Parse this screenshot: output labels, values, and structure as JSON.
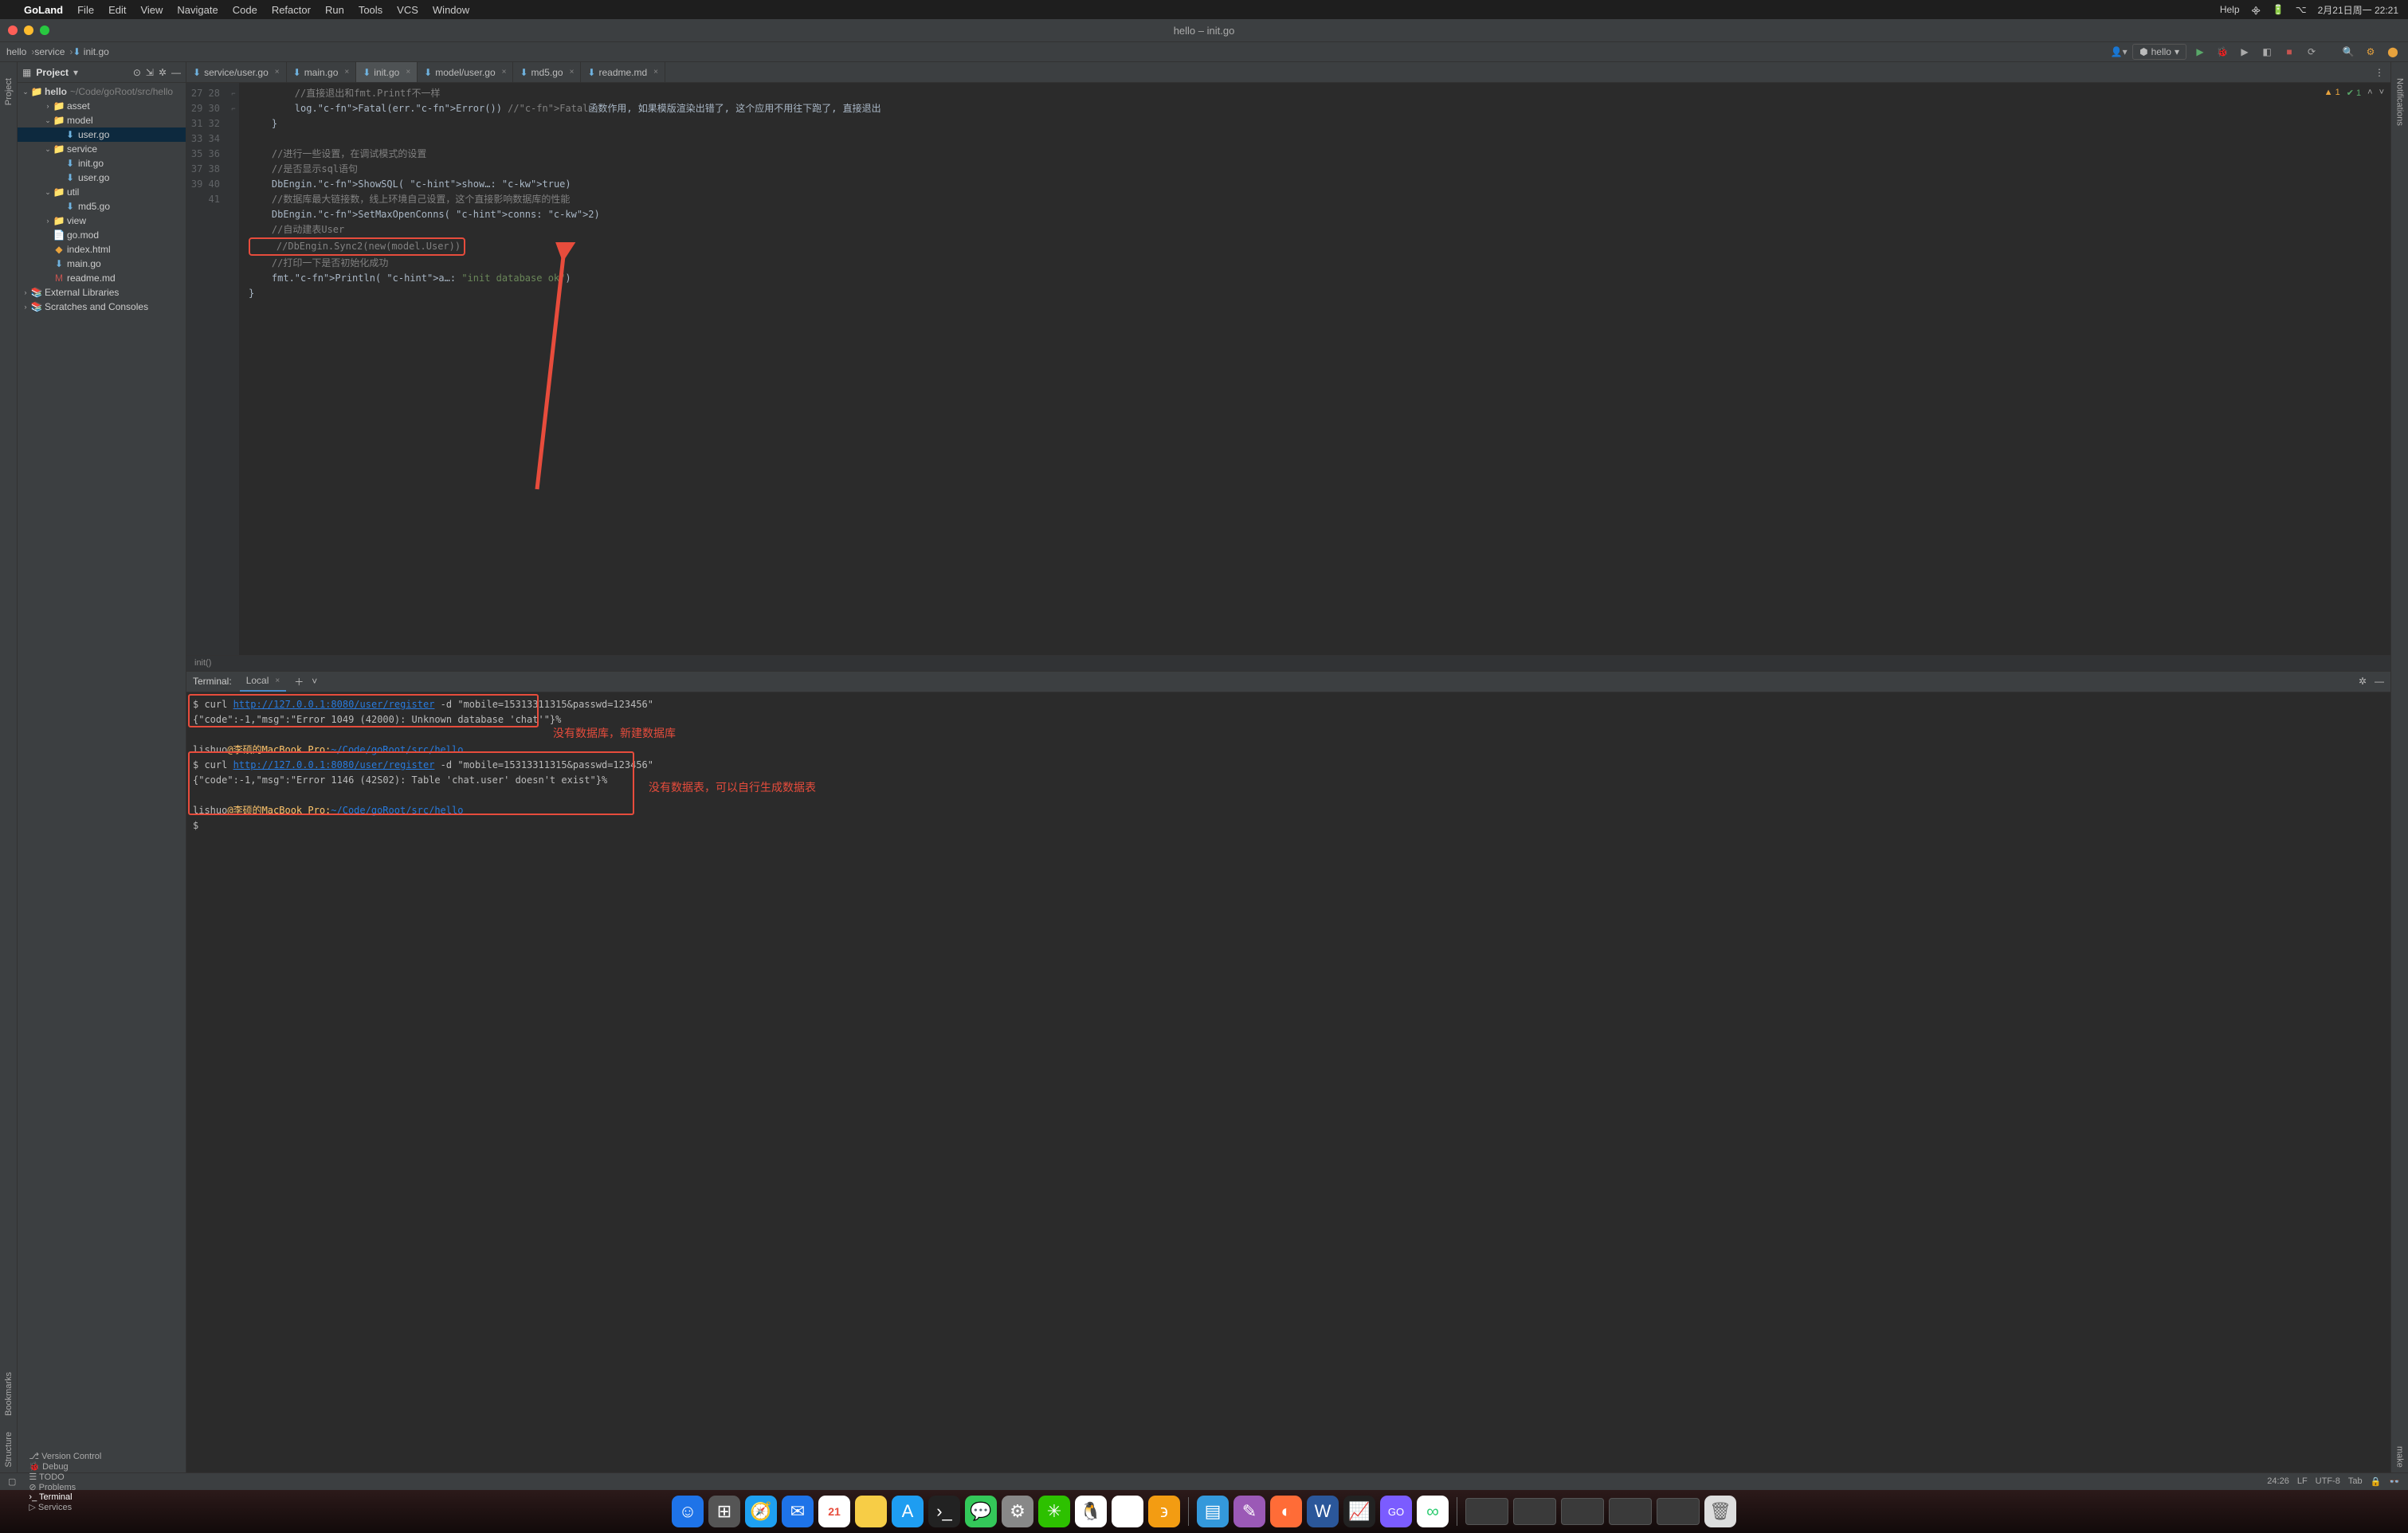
{
  "macbar": {
    "app": "GoLand",
    "menus": [
      "File",
      "Edit",
      "View",
      "Navigate",
      "Code",
      "Refactor",
      "Run",
      "Tools",
      "VCS",
      "Window"
    ],
    "help": "Help",
    "clock": "2月21日周一 22:21"
  },
  "titlebar": {
    "title": "hello – init.go"
  },
  "breadcrumbs": [
    "hello",
    "service",
    "init.go"
  ],
  "run_config": "hello",
  "project": {
    "title": "Project",
    "root": {
      "name": "hello",
      "path": "~/Code/goRoot/src/hello"
    },
    "tree": [
      {
        "name": "asset",
        "type": "dir",
        "depth": 2,
        "open": false
      },
      {
        "name": "model",
        "type": "dir",
        "depth": 2,
        "open": true
      },
      {
        "name": "user.go",
        "type": "go",
        "depth": 3,
        "sel": true
      },
      {
        "name": "service",
        "type": "dir",
        "depth": 2,
        "open": true
      },
      {
        "name": "init.go",
        "type": "go",
        "depth": 3
      },
      {
        "name": "user.go",
        "type": "go",
        "depth": 3
      },
      {
        "name": "util",
        "type": "dir",
        "depth": 2,
        "open": true
      },
      {
        "name": "md5.go",
        "type": "go",
        "depth": 3
      },
      {
        "name": "view",
        "type": "dir",
        "depth": 2,
        "open": false
      },
      {
        "name": "go.mod",
        "type": "file",
        "depth": 2
      },
      {
        "name": "index.html",
        "type": "html",
        "depth": 2
      },
      {
        "name": "main.go",
        "type": "go",
        "depth": 2
      },
      {
        "name": "readme.md",
        "type": "md",
        "depth": 2
      }
    ],
    "extra": [
      "External Libraries",
      "Scratches and Consoles"
    ]
  },
  "tabs": [
    {
      "file": "service/user.go"
    },
    {
      "file": "main.go"
    },
    {
      "file": "init.go",
      "active": true
    },
    {
      "file": "model/user.go"
    },
    {
      "file": "md5.go"
    },
    {
      "file": "readme.md"
    }
  ],
  "gutter_start": 27,
  "code_lines": [
    {
      "t": "cmt",
      "txt": "        //直接退出和fmt.Printf不一样"
    },
    {
      "t": "code",
      "txt": "        log.Fatal(err.Error()) //Fatal函数作用, 如果模版渲染出错了, 这个应用不用往下跑了, 直接退出"
    },
    {
      "t": "code",
      "txt": "    }"
    },
    {
      "t": "blank",
      "txt": ""
    },
    {
      "t": "cmt",
      "txt": "    //进行一些设置，在调试模式的设置"
    },
    {
      "t": "cmt",
      "txt": "    //是否显示sql语句"
    },
    {
      "t": "code",
      "txt": "    DbEngin.ShowSQL( show…: true)"
    },
    {
      "t": "cmt",
      "txt": "    //数据库最大链接数，线上环境自己设置，这个直接影响数据库的性能"
    },
    {
      "t": "code",
      "txt": "    DbEngin.SetMaxOpenConns( conns: 2)"
    },
    {
      "t": "cmt",
      "txt": "    //自动建表User"
    },
    {
      "t": "hi",
      "txt": "    //DbEngin.Sync2(new(model.User))"
    },
    {
      "t": "cmt",
      "txt": "    //打印一下是否初始化成功"
    },
    {
      "t": "code",
      "txt": "    fmt.Println( a…: \"init database ok\")"
    },
    {
      "t": "code",
      "txt": "}"
    },
    {
      "t": "blank",
      "txt": ""
    }
  ],
  "breadcrumb2": "init()",
  "inspection": {
    "warn": "1",
    "ok": "1"
  },
  "terminal": {
    "title": "Terminal:",
    "tab": "Local",
    "lines": [
      {
        "seg": [
          {
            "c": "p",
            "t": "$ curl "
          },
          {
            "c": "u",
            "t": "http://127.0.0.1:8080/user/register"
          },
          {
            "c": "p",
            "t": " -d \"mobile=15313311315&passwd=123456\""
          }
        ]
      },
      {
        "seg": [
          {
            "c": "p",
            "t": "{\"code\":-1,\"msg\":\"Error 1049 (42000): Unknown database 'chat'\"}%"
          }
        ]
      },
      {
        "seg": []
      },
      {
        "seg": [
          {
            "c": "user",
            "t": "lishuo"
          },
          {
            "c": "at",
            "t": "@李硕的MacBook Pro:"
          },
          {
            "c": "path",
            "t": "~/Code/goRoot/src/hello"
          }
        ]
      },
      {
        "seg": [
          {
            "c": "p",
            "t": "$ curl "
          },
          {
            "c": "u",
            "t": "http://127.0.0.1:8080/user/register"
          },
          {
            "c": "p",
            "t": " -d \"mobile=15313311315&passwd=123456\""
          }
        ]
      },
      {
        "seg": [
          {
            "c": "p",
            "t": "{\"code\":-1,\"msg\":\"Error 1146 (42S02): Table 'chat.user' doesn't exist\"}%"
          }
        ]
      },
      {
        "seg": []
      },
      {
        "seg": [
          {
            "c": "user",
            "t": "lishuo"
          },
          {
            "c": "at",
            "t": "@李硕的MacBook Pro:"
          },
          {
            "c": "path",
            "t": "~/Code/goRoot/src/hello"
          }
        ]
      },
      {
        "seg": [
          {
            "c": "p",
            "t": "$ "
          }
        ]
      }
    ],
    "annot1": "没有数据库，新建数据库",
    "annot2": "没有数据表，可以自行生成数据表"
  },
  "bottom": {
    "items": [
      "Version Control",
      "Debug",
      "TODO",
      "Problems",
      "Terminal",
      "Services"
    ],
    "active": "Terminal"
  },
  "status": {
    "pos": "24:26",
    "eol": "LF",
    "enc": "UTF-8",
    "indent": "Tab"
  },
  "leftstrip": [
    "Project",
    "Bookmarks",
    "Structure"
  ],
  "rightstrip": [
    "Notifications",
    "make"
  ]
}
